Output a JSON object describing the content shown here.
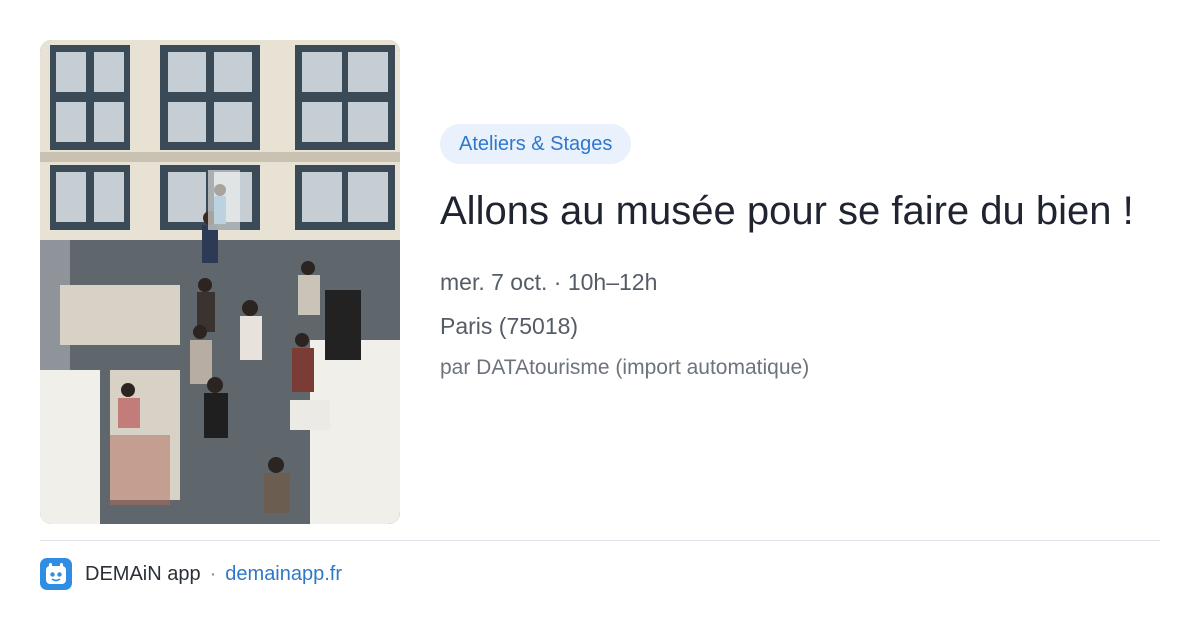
{
  "card": {
    "image_description_icon": "museum-photo",
    "category": "Ateliers & Stages",
    "title": "Allons au musée pour se faire du bien !",
    "datetime": "mer. 7 oct. · 10h–12h",
    "location": "Paris (75018)",
    "source": "par DATAtourisme (import automatique)"
  },
  "footer": {
    "app_icon": "demain-app-icon",
    "app_name": "DEMAiN app",
    "separator": "·",
    "domain": "demainapp.fr"
  },
  "colors": {
    "chip_bg": "#e9f1fd",
    "chip_text": "#2f78c9",
    "title": "#1f2430",
    "link": "#2f78c9",
    "app_icon_bg": "#2f8de4"
  }
}
